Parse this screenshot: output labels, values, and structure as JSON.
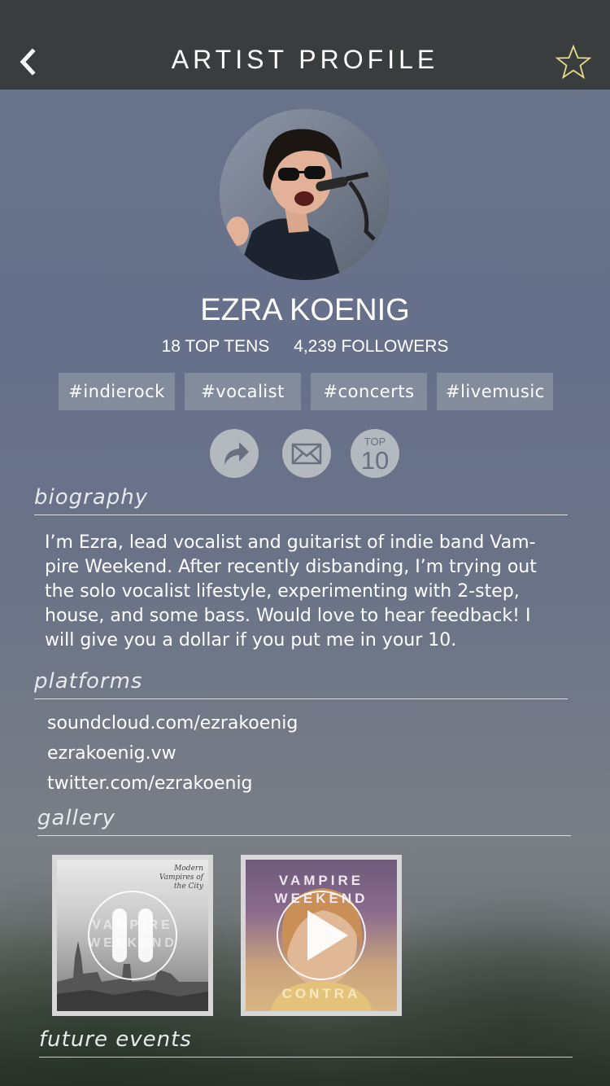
{
  "header": {
    "title": "ARTIST PROFILE",
    "back_icon": "chevron-left-icon",
    "favorite_icon": "star-outline-icon",
    "star_color": "#e6d88a"
  },
  "artist": {
    "name": "EZRA KOENIG",
    "top_tens": "18 TOP TENS",
    "followers": "4,239 FOLLOWERS",
    "tags": [
      "#indierock",
      "#vocalist",
      "#concerts",
      "#livemusic"
    ]
  },
  "actions": {
    "share_icon": "share-arrow-icon",
    "message_icon": "mail-icon",
    "top10_top": "TOP",
    "top10_num": "10"
  },
  "sections": {
    "biography": "biography",
    "platforms": "platforms",
    "gallery": "gallery",
    "future_events": "future events"
  },
  "biography_text": "I’m Ezra, lead vocalist and guitarist of indie band Vam-pire Weekend. After recently disbanding, I’m trying out the solo vocalist lifestyle, experimenting with 2-step, house, and some bass. Would love to hear feedback! I will give you a dollar if you put me in your 10.",
  "platforms": [
    "soundcloud.com/ezrakoenig",
    "ezrakoenig.vw",
    "twitter.com/ezrakoenig"
  ],
  "gallery": [
    {
      "cover_line1": "VAMPIRE",
      "cover_line2": "WEEKEND",
      "script": "Modern Vampires of the City",
      "state": "playing",
      "control_icon": "pause-icon"
    },
    {
      "cover_line1": "VAMPIRE",
      "cover_line2": "WEEKEND",
      "cover_line3": "CONTRA",
      "state": "paused",
      "control_icon": "play-icon"
    }
  ]
}
